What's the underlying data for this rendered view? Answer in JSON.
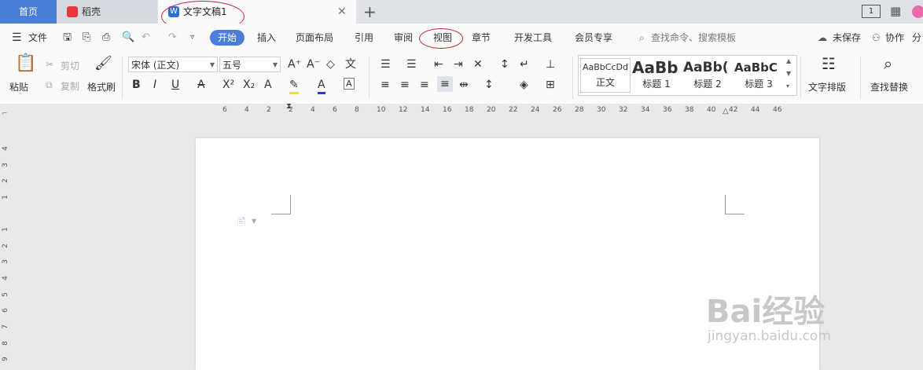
{
  "tabs": {
    "home": "首页",
    "daoke": "稻壳",
    "document": "文字文稿1"
  },
  "menu": {
    "file": "文件",
    "items": [
      "开始",
      "插入",
      "页面布局",
      "引用",
      "审阅",
      "视图",
      "章节",
      "开发工具",
      "会员专享"
    ],
    "search_placeholder": "查找命令、搜索模板",
    "unsaved": "未保存",
    "collab": "协作",
    "share": "分"
  },
  "ribbon": {
    "paste": "粘贴",
    "cut": "剪切",
    "copy": "复制",
    "format_painter": "格式刷",
    "font_name": "宋体 (正文)",
    "font_size": "五号",
    "styles": [
      {
        "preview": "AaBbCcDd",
        "label": "正文"
      },
      {
        "preview": "AaBb",
        "label": "标题 1"
      },
      {
        "preview": "AaBb(",
        "label": "标题 2"
      },
      {
        "preview": "AaBbC",
        "label": "标题 3"
      }
    ],
    "text_layout": "文字排版",
    "find_replace": "查找替换"
  },
  "ruler": {
    "h_ticks": [
      "6",
      "4",
      "2",
      "2",
      "4",
      "6",
      "8",
      "10",
      "12",
      "14",
      "16",
      "18",
      "20",
      "22",
      "24",
      "26",
      "28",
      "30",
      "32",
      "34",
      "36",
      "38",
      "40",
      "42",
      "44",
      "46"
    ],
    "v_ticks": [
      "4",
      "3",
      "2",
      "1",
      "1",
      "2",
      "3",
      "4",
      "5",
      "6",
      "7",
      "8",
      "9"
    ]
  },
  "watermark": {
    "logo": "Bai经验",
    "url": "jingyan.baidu.com"
  },
  "colors": {
    "accent": "#4a7ed8",
    "annotation": "#c0282d",
    "daoke_red": "#e8383d"
  }
}
